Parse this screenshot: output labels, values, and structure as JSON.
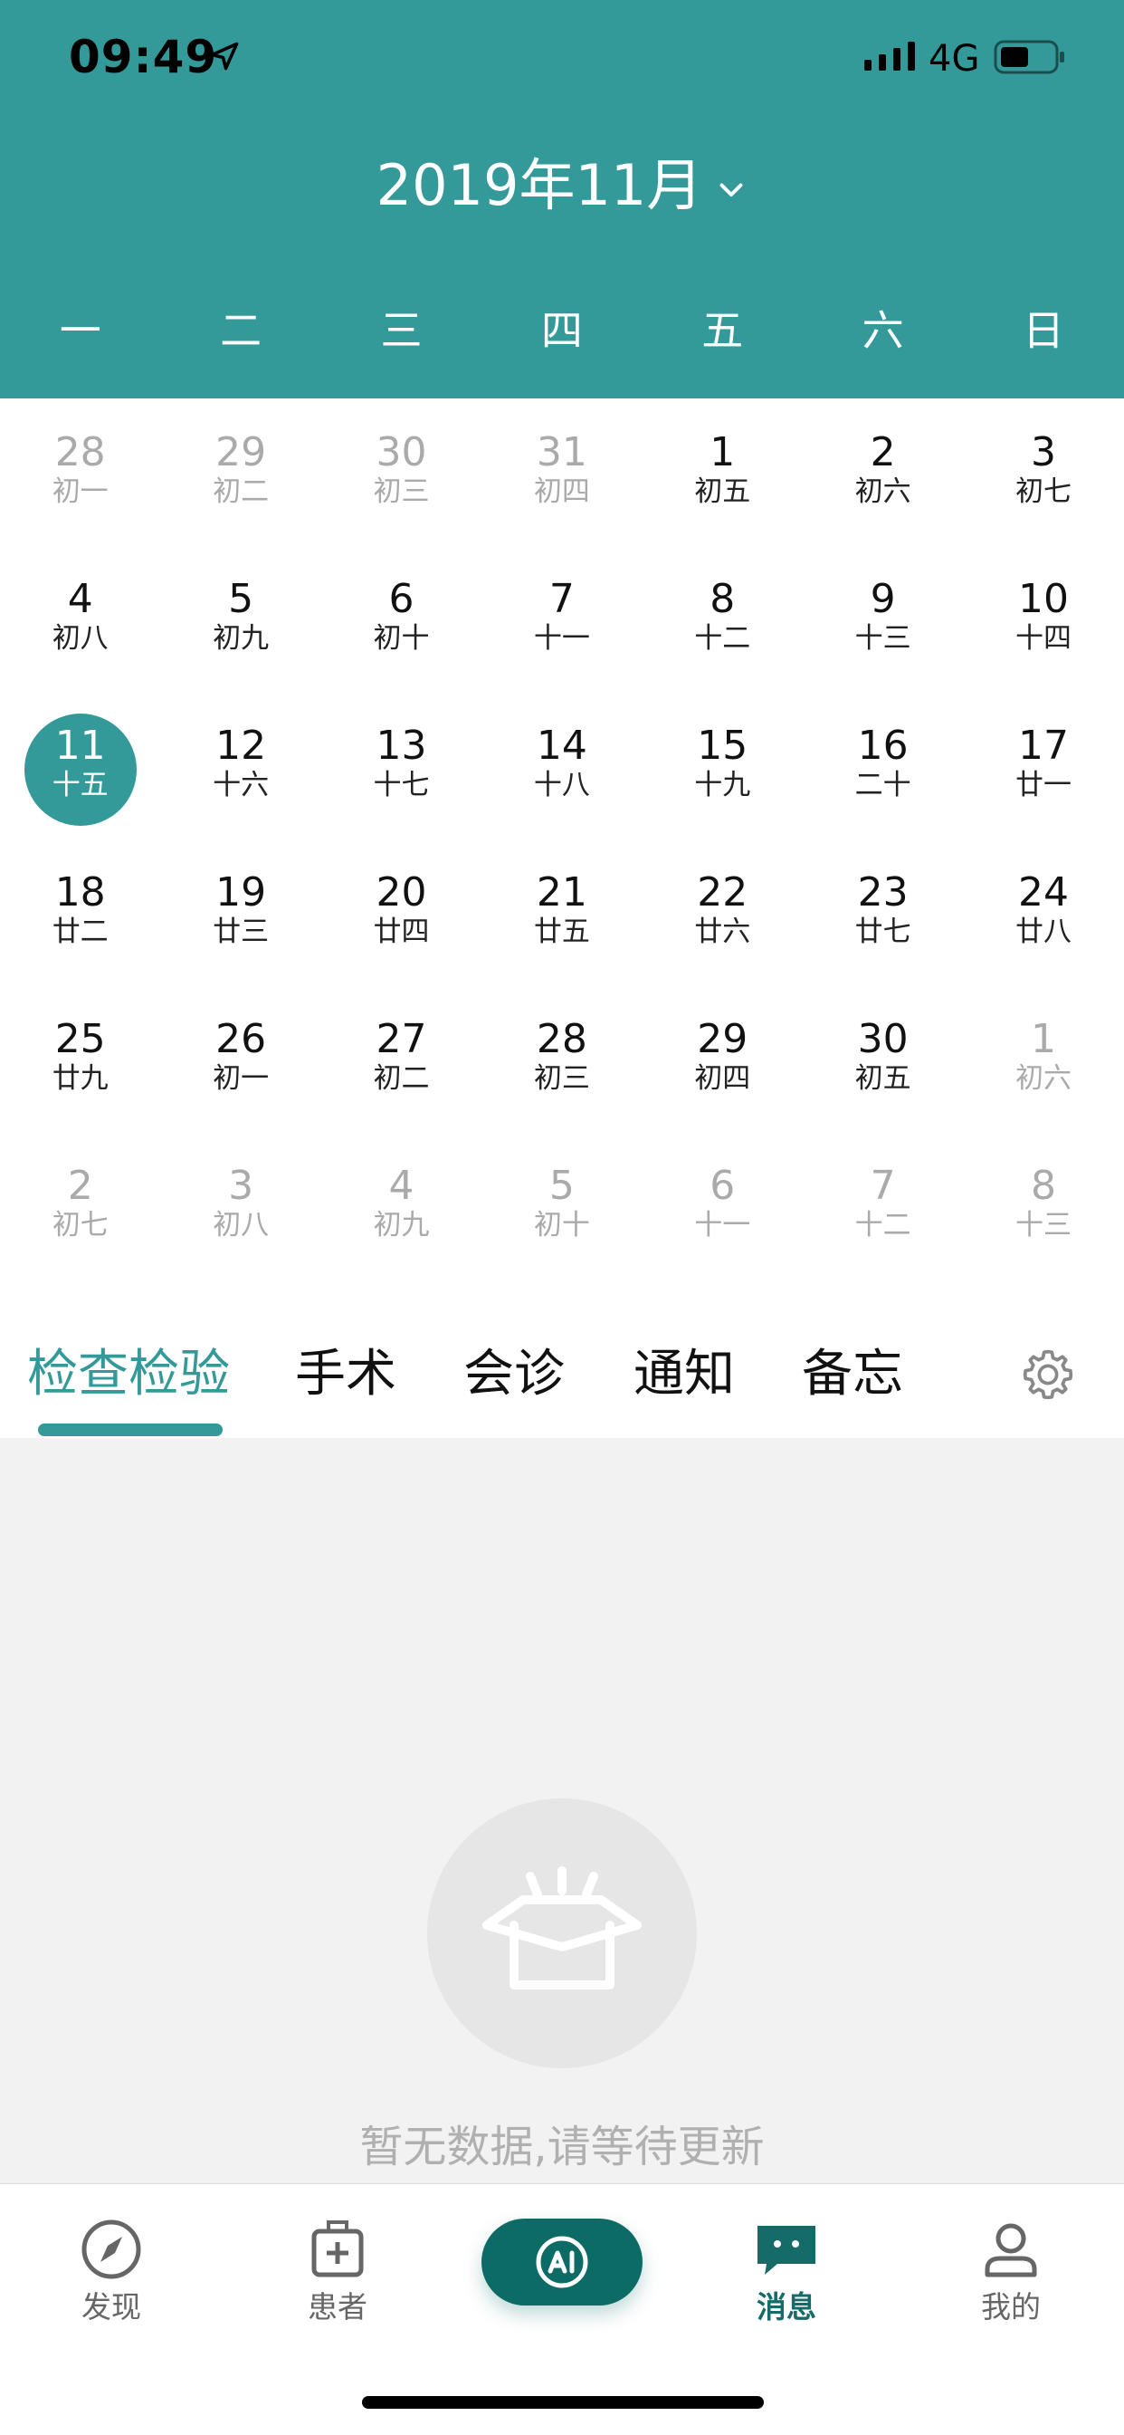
{
  "status_bar": {
    "time": "09:49",
    "network": "4G"
  },
  "header": {
    "month_title": "2019年11月"
  },
  "weekdays": [
    "一",
    "二",
    "三",
    "四",
    "五",
    "六",
    "日"
  ],
  "calendar": {
    "rows": [
      [
        {
          "day": "28",
          "lunar": "初一",
          "other": true
        },
        {
          "day": "29",
          "lunar": "初二",
          "other": true
        },
        {
          "day": "30",
          "lunar": "初三",
          "other": true
        },
        {
          "day": "31",
          "lunar": "初四",
          "other": true
        },
        {
          "day": "1",
          "lunar": "初五"
        },
        {
          "day": "2",
          "lunar": "初六"
        },
        {
          "day": "3",
          "lunar": "初七"
        }
      ],
      [
        {
          "day": "4",
          "lunar": "初八"
        },
        {
          "day": "5",
          "lunar": "初九"
        },
        {
          "day": "6",
          "lunar": "初十"
        },
        {
          "day": "7",
          "lunar": "十一"
        },
        {
          "day": "8",
          "lunar": "十二"
        },
        {
          "day": "9",
          "lunar": "十三"
        },
        {
          "day": "10",
          "lunar": "十四"
        }
      ],
      [
        {
          "day": "11",
          "lunar": "十五",
          "selected": true
        },
        {
          "day": "12",
          "lunar": "十六"
        },
        {
          "day": "13",
          "lunar": "十七"
        },
        {
          "day": "14",
          "lunar": "十八"
        },
        {
          "day": "15",
          "lunar": "十九"
        },
        {
          "day": "16",
          "lunar": "二十"
        },
        {
          "day": "17",
          "lunar": "廿一"
        }
      ],
      [
        {
          "day": "18",
          "lunar": "廿二"
        },
        {
          "day": "19",
          "lunar": "廿三"
        },
        {
          "day": "20",
          "lunar": "廿四"
        },
        {
          "day": "21",
          "lunar": "廿五"
        },
        {
          "day": "22",
          "lunar": "廿六"
        },
        {
          "day": "23",
          "lunar": "廿七"
        },
        {
          "day": "24",
          "lunar": "廿八"
        }
      ],
      [
        {
          "day": "25",
          "lunar": "廿九"
        },
        {
          "day": "26",
          "lunar": "初一"
        },
        {
          "day": "27",
          "lunar": "初二"
        },
        {
          "day": "28",
          "lunar": "初三"
        },
        {
          "day": "29",
          "lunar": "初四"
        },
        {
          "day": "30",
          "lunar": "初五"
        },
        {
          "day": "1",
          "lunar": "初六",
          "other": true
        }
      ],
      [
        {
          "day": "2",
          "lunar": "初七",
          "other": true
        },
        {
          "day": "3",
          "lunar": "初八",
          "other": true
        },
        {
          "day": "4",
          "lunar": "初九",
          "other": true
        },
        {
          "day": "5",
          "lunar": "初十",
          "other": true
        },
        {
          "day": "6",
          "lunar": "十一",
          "other": true
        },
        {
          "day": "7",
          "lunar": "十二",
          "other": true
        },
        {
          "day": "8",
          "lunar": "十三",
          "other": true
        }
      ]
    ]
  },
  "tabs": [
    {
      "label": "检查检验",
      "active": true
    },
    {
      "label": "手术"
    },
    {
      "label": "会诊"
    },
    {
      "label": "通知"
    },
    {
      "label": "备忘"
    }
  ],
  "empty_state": {
    "message": "暂无数据,请等待更新"
  },
  "bottom_nav": {
    "discover": "发现",
    "patients": "患者",
    "messages": "消息",
    "mine": "我的"
  },
  "colors": {
    "accent": "#349a99",
    "nav_active": "#146b67",
    "ai_button": "#0d6b66"
  },
  "icons": [
    "location-arrow-icon",
    "signal-icon",
    "battery-icon",
    "chevron-down-icon",
    "gear-icon",
    "empty-inbox-icon",
    "compass-icon",
    "medical-kit-icon",
    "ai-icon",
    "chat-icon",
    "user-icon"
  ]
}
